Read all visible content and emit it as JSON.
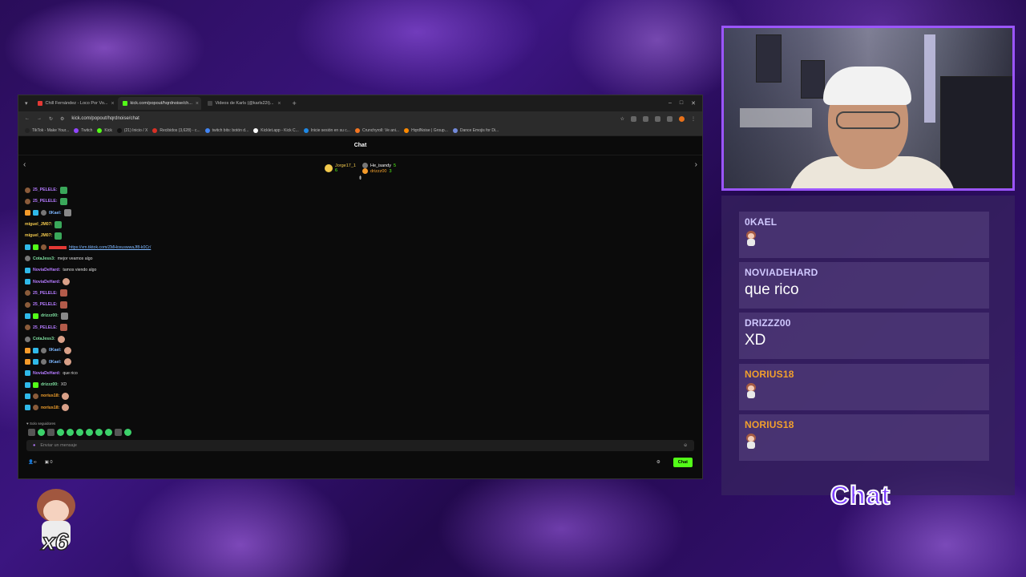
{
  "browser": {
    "tabs": [
      {
        "title": "Chill Fernández - Loco Por Vo...",
        "color": "#e53935",
        "active": false
      },
      {
        "title": "kick.com/popout/hqrdnoise/ch...",
        "color": "#53fc18",
        "active": true
      },
      {
        "title": "Videos de Karls (@karls22t)...",
        "color": "#222222",
        "active": false
      }
    ],
    "url": "kick.com/popout/hqrdnoise/chat",
    "bookmarks": [
      {
        "label": "TikTok - Make Your...",
        "color": "#222222"
      },
      {
        "label": "Twitch",
        "color": "#9146ff"
      },
      {
        "label": "Kick",
        "color": "#53fc18"
      },
      {
        "label": "(21) Inicio / X",
        "color": "#111111"
      },
      {
        "label": "Recibidos (3,628) - c...",
        "color": "#d93025"
      },
      {
        "label": "twitch bits: botón d...",
        "color": "#4285f4"
      },
      {
        "label": "Kicklet.app - Kick C...",
        "color": "#ffffff"
      },
      {
        "label": "Inicie sesión en su c...",
        "color": "#1e88e5"
      },
      {
        "label": "Crunchyroll: Ve ani...",
        "color": "#f47521"
      },
      {
        "label": "HqrdNoise | Group...",
        "color": "#ff8a00"
      },
      {
        "label": "Dance Emojis for Di...",
        "color": "#7289da"
      }
    ]
  },
  "kick_chat": {
    "header": "Chat",
    "pinned": {
      "first": {
        "name": "Jorge17_1",
        "count": "6"
      },
      "second": {
        "name": "He_isandy",
        "count": "5"
      },
      "third": {
        "name": "drizzz00",
        "count": "3"
      }
    },
    "messages": [
      {
        "badges": [
          "b-brown"
        ],
        "user": "25_PELELE:",
        "color": "#b57bff",
        "text": "",
        "emote": "e-green"
      },
      {
        "badges": [
          "b-brown"
        ],
        "user": "25_PELELE:",
        "color": "#b57bff",
        "text": "",
        "emote": "e-green"
      },
      {
        "badges": [
          "b-orange",
          "b-blue",
          "b-gray"
        ],
        "user": "0Kael:",
        "color": "#7db7ff",
        "text": "",
        "emote": "e-gray"
      },
      {
        "badges": [],
        "user": "miguel_JM07:",
        "color": "#f2c94c",
        "text": "",
        "emote": "e-green"
      },
      {
        "badges": [],
        "user": "miguel_JM07:",
        "color": "#f2c94c",
        "text": "",
        "emote": "e-green"
      },
      {
        "badges": [
          "b-blue",
          "b-green",
          "b-brown"
        ],
        "user": "",
        "color": "#e53935",
        "text": "https://vm.tiktok.com/ZMHoxuswwaJf8-k0Cr/",
        "emote": "",
        "link": true
      },
      {
        "badges": [
          "b-gray"
        ],
        "user": "CotaJess3:",
        "color": "#7fe0a0",
        "text": "mejor veamos algo",
        "emote": ""
      },
      {
        "badges": [
          "b-blue"
        ],
        "user": "NoviaDeHard:",
        "color": "#b57bff",
        "text": "tamos viendo algo",
        "emote": ""
      },
      {
        "badges": [
          "b-blue"
        ],
        "user": "NoviaDeHard:",
        "color": "#b57bff",
        "text": "",
        "emote": "e-girl"
      },
      {
        "badges": [
          "b-brown"
        ],
        "user": "25_PELELE:",
        "color": "#b57bff",
        "text": "",
        "emote": "e-red"
      },
      {
        "badges": [
          "b-brown"
        ],
        "user": "25_PELELE:",
        "color": "#b57bff",
        "text": "",
        "emote": "e-red"
      },
      {
        "badges": [
          "b-blue",
          "b-green"
        ],
        "user": "drizzz00:",
        "color": "#7fe0a0",
        "text": "",
        "emote": "e-gray"
      },
      {
        "badges": [
          "b-brown"
        ],
        "user": "25_PELELE:",
        "color": "#b57bff",
        "text": "",
        "emote": "e-red"
      },
      {
        "badges": [
          "b-gray"
        ],
        "user": "CotaJess3:",
        "color": "#7fe0a0",
        "text": "",
        "emote": "e-girl"
      },
      {
        "badges": [
          "b-orange",
          "b-blue",
          "b-gray"
        ],
        "user": "0Kael:",
        "color": "#7db7ff",
        "text": "",
        "emote": "e-girl"
      },
      {
        "badges": [
          "b-orange",
          "b-blue",
          "b-gray"
        ],
        "user": "0Kael:",
        "color": "#7db7ff",
        "text": "",
        "emote": "e-girl"
      },
      {
        "badges": [
          "b-blue"
        ],
        "user": "NoviaDeHard:",
        "color": "#b57bff",
        "text": "que rico",
        "emote": ""
      },
      {
        "badges": [
          "b-blue",
          "b-green"
        ],
        "user": "drizzz00:",
        "color": "#7fe0a0",
        "text": "XD",
        "emote": ""
      },
      {
        "badges": [
          "b-blue",
          "b-brown"
        ],
        "user": "norius18:",
        "color": "#f2a02c",
        "text": "",
        "emote": "e-girl"
      },
      {
        "badges": [
          "b-blue",
          "b-brown"
        ],
        "user": "norius18:",
        "color": "#f2a02c",
        "text": "",
        "emote": "e-girl"
      }
    ],
    "followers_only": "Solo seguidores",
    "input_placeholder": "Enviar un mensaje",
    "viewer_label": "∞",
    "points": "0",
    "send_button": "Chat"
  },
  "overlay": {
    "messages": [
      {
        "user": "0KAEL",
        "color": "#d0c8ff",
        "text": "",
        "emote": true
      },
      {
        "user": "NOVIADEHARD",
        "color": "#d0c8ff",
        "text": "que rico",
        "emote": false
      },
      {
        "user": "DRIZZZ00",
        "color": "#d0c8ff",
        "text": "XD",
        "emote": false
      },
      {
        "user": "NORIUS18",
        "color": "#f2a02c",
        "text": "",
        "emote": true
      },
      {
        "user": "NORIUS18",
        "color": "#f2a02c",
        "text": "",
        "emote": true
      }
    ],
    "label": "Chat"
  },
  "emote_counter": "x6"
}
